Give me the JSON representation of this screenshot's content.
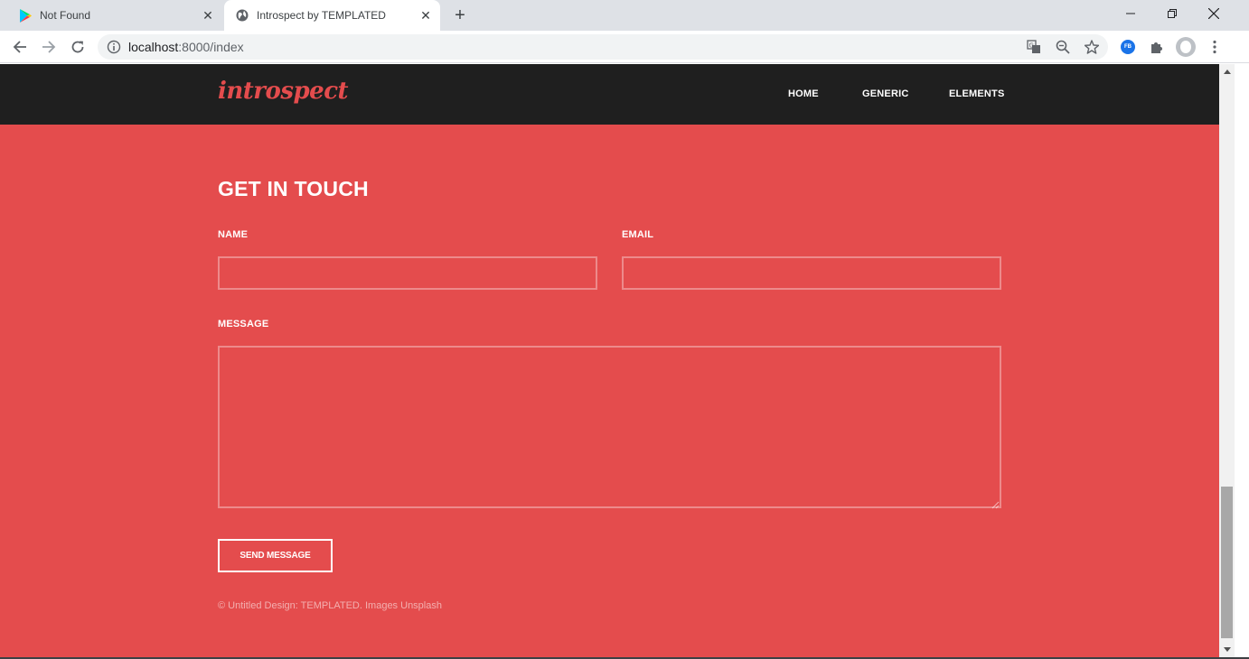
{
  "browser": {
    "tabs": [
      {
        "title": "Not Found",
        "favicon": "play-store-icon",
        "active": false
      },
      {
        "title": "Introspect by TEMPLATED",
        "favicon": "globe-icon",
        "active": true
      }
    ],
    "url_host": "localhost",
    "url_rest": ":8000/index",
    "extension_badge": "FB"
  },
  "site": {
    "logo": "introspect",
    "nav": [
      {
        "label": "HOME"
      },
      {
        "label": "GENERIC"
      },
      {
        "label": "ELEMENTS"
      }
    ]
  },
  "contact": {
    "title": "GET IN TOUCH",
    "name_label": "NAME",
    "email_label": "EMAIL",
    "message_label": "MESSAGE",
    "name_value": "",
    "email_value": "",
    "message_value": "",
    "submit_label": "SEND MESSAGE"
  },
  "footer": {
    "copyright_prefix": "© Untitled Design: ",
    "templated": "TEMPLATED",
    "images_prefix": ". Images ",
    "unsplash": "Unsplash"
  },
  "colors": {
    "accent": "#e44c4d",
    "header_bg": "#1f1f1f",
    "text_on_accent": "#ffffff"
  }
}
